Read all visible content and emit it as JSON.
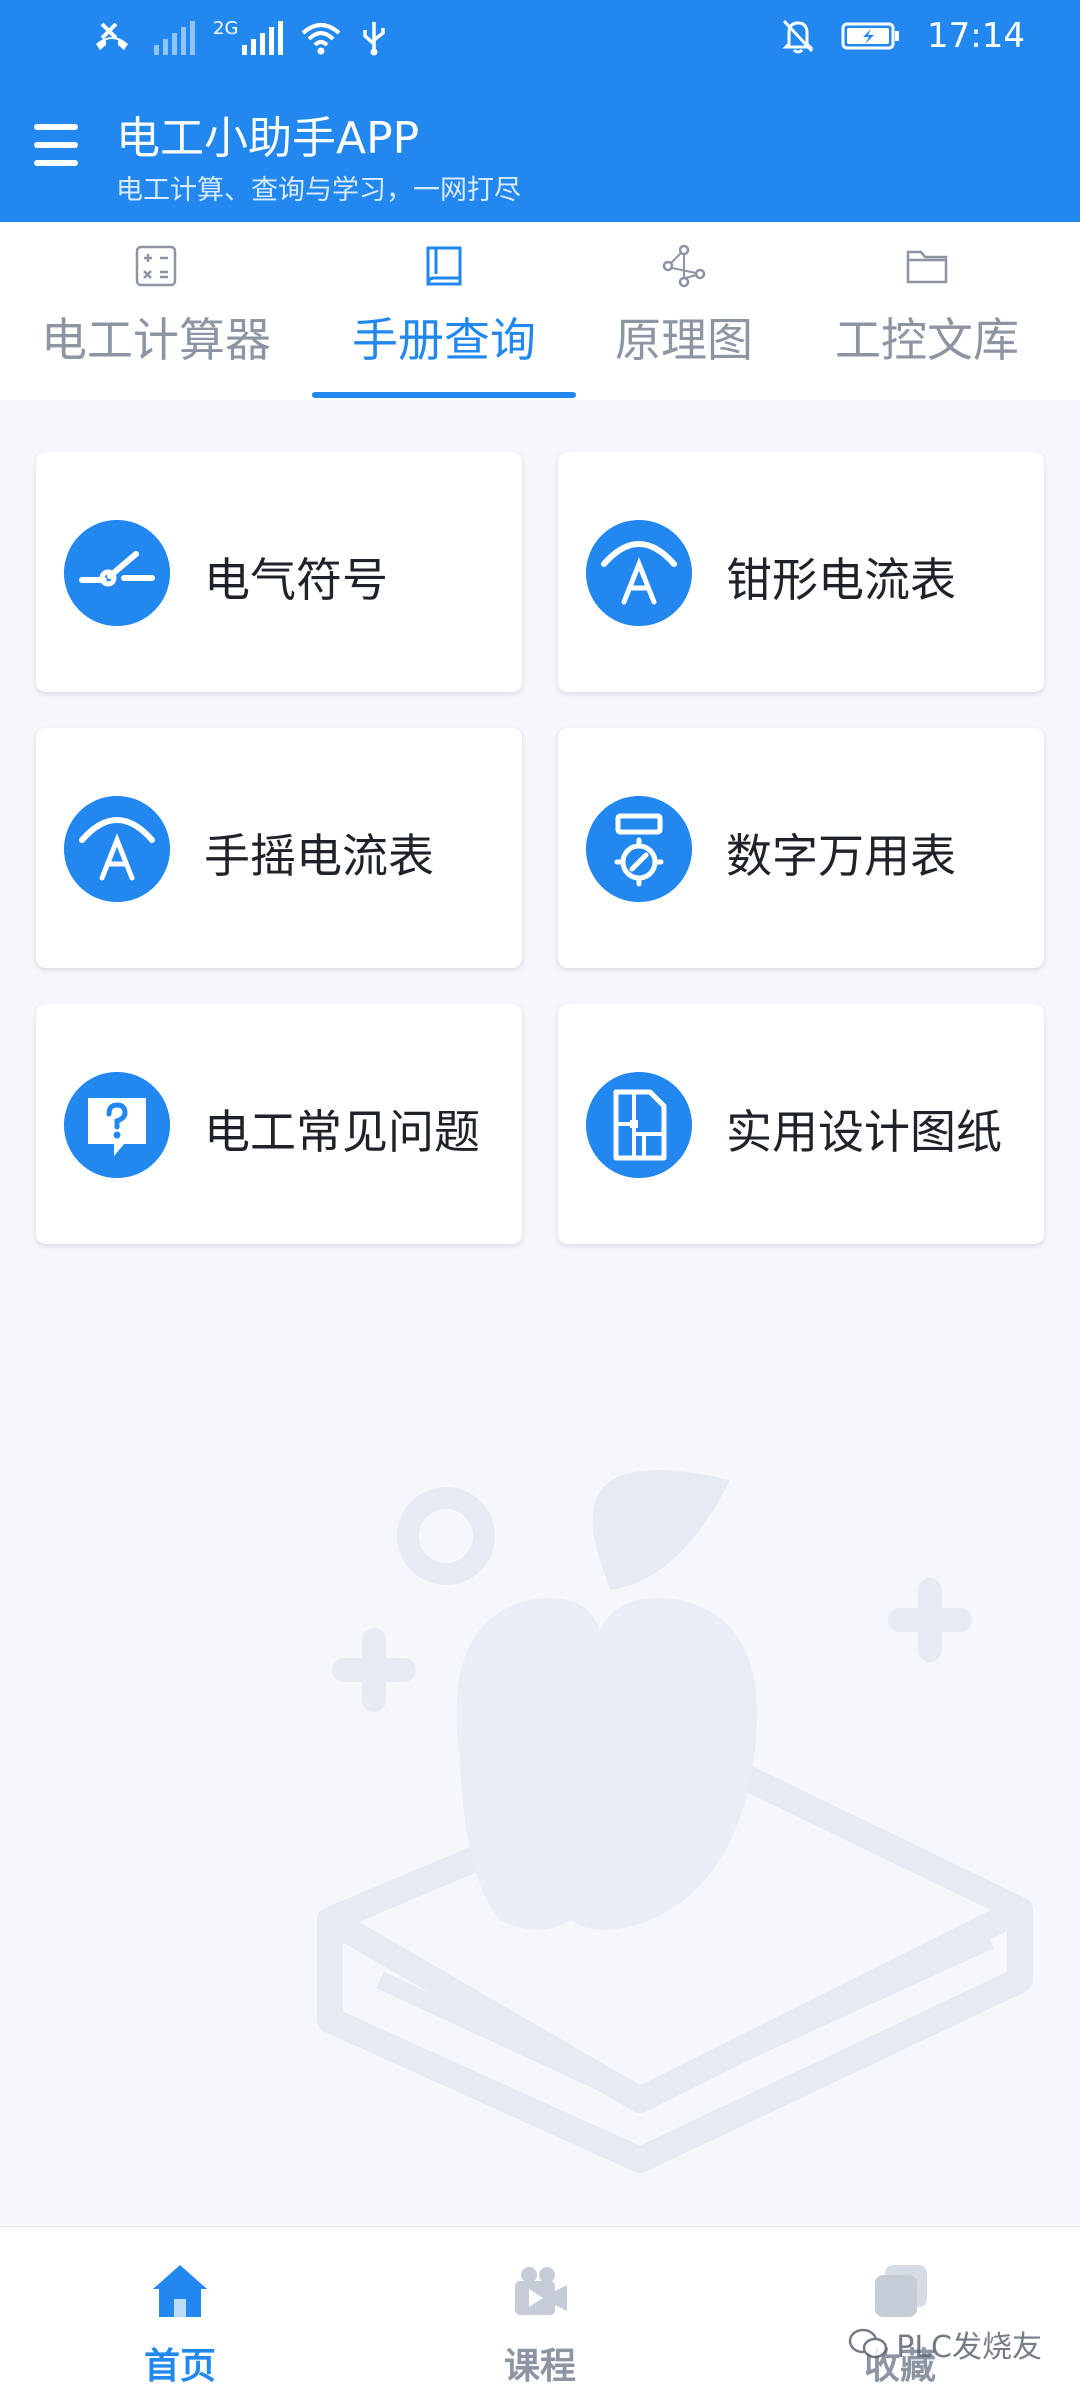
{
  "status_bar": {
    "network_type": "2G",
    "time": "17:14",
    "icons": [
      "missed-call-icon",
      "signal-icon",
      "signal-2g-icon",
      "wifi-icon",
      "usb-icon",
      "bell-muted-icon",
      "battery-icon"
    ]
  },
  "header": {
    "title": "电工小助手APP",
    "subtitle": "电工计算、查询与学习，一网打尽",
    "menu_icon": "hamburger-icon"
  },
  "tabs": [
    {
      "label": "电工计算器",
      "icon": "calculator-icon",
      "active": false
    },
    {
      "label": "手册查询",
      "icon": "book-icon",
      "active": true
    },
    {
      "label": "原理图",
      "icon": "share-graph-icon",
      "active": false
    },
    {
      "label": "工控文库",
      "icon": "folder-icon",
      "active": false
    }
  ],
  "cards": [
    {
      "label": "电气符号",
      "icon": "switch-symbol-icon"
    },
    {
      "label": "钳形电流表",
      "icon": "ammeter-icon"
    },
    {
      "label": "手摇电流表",
      "icon": "ammeter-icon"
    },
    {
      "label": "数字万用表",
      "icon": "multimeter-icon"
    },
    {
      "label": "电工常见问题",
      "icon": "question-bubble-icon"
    },
    {
      "label": "实用设计图纸",
      "icon": "blueprint-icon"
    }
  ],
  "bottom_nav": [
    {
      "label": "首页",
      "icon": "home-icon",
      "active": true
    },
    {
      "label": "课程",
      "icon": "video-icon",
      "active": false
    },
    {
      "label": "收藏",
      "icon": "stack-icon",
      "active": false
    }
  ],
  "watermark": "PLC发烧友",
  "colors": {
    "primary": "#2288f0",
    "inactive": "#8d95a3",
    "background": "#f5f7fb"
  }
}
